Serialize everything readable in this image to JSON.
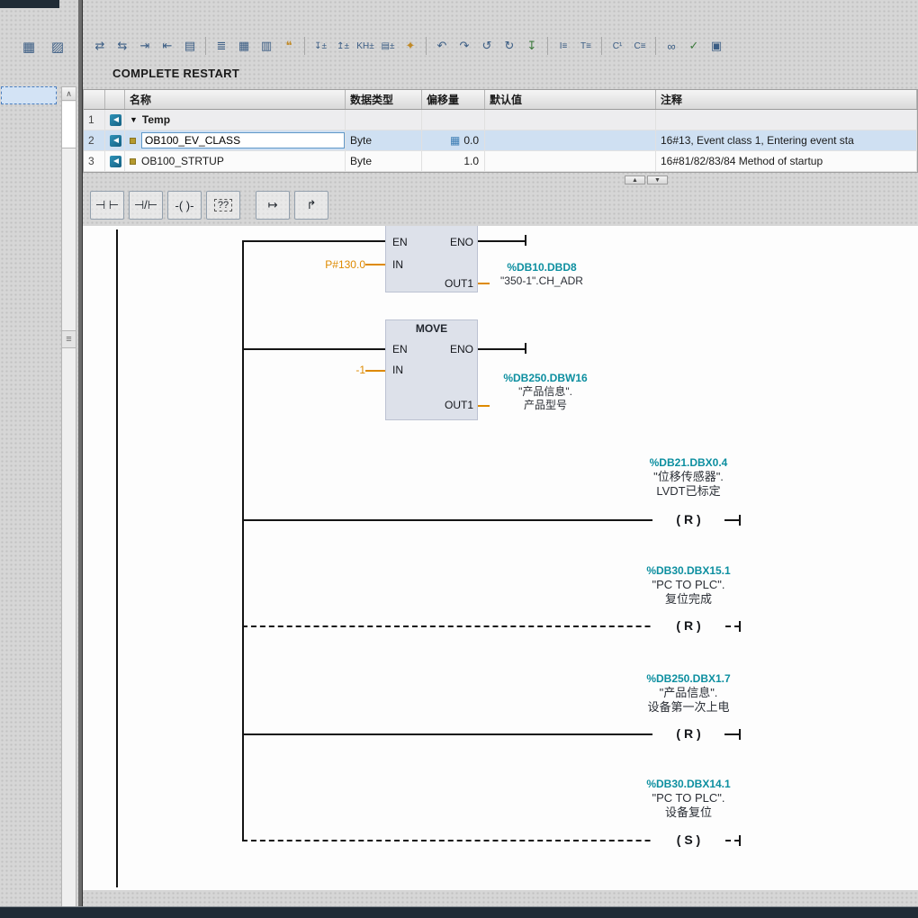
{
  "colors": {
    "teal": "#0d8fa0",
    "orange": "#de8a00",
    "selection": "#cfe0f2",
    "chrome": "#202b36",
    "wire": "#141414"
  },
  "title": "COMPLETE RESTART",
  "left_toolbar": {
    "icons": [
      {
        "name": "overview-icon",
        "glyph": "▦"
      },
      {
        "name": "detail-view-icon",
        "glyph": "▨"
      }
    ]
  },
  "toolbar": {
    "icons": [
      {
        "name": "insert-network-icon",
        "glyph": "⇄"
      },
      {
        "name": "delete-network-icon",
        "glyph": "⇆"
      },
      {
        "name": "indent-right-icon",
        "glyph": "⇥"
      },
      {
        "name": "indent-left-icon",
        "glyph": "⇤"
      },
      {
        "name": "insert-row-icon",
        "glyph": "▤"
      },
      {
        "name": "network-list-icon",
        "glyph": "≣"
      },
      {
        "name": "network-overview-icon",
        "glyph": "▦"
      },
      {
        "name": "network-compact-icon",
        "glyph": "▥"
      },
      {
        "name": "comment-toggle-icon",
        "glyph": "❝"
      },
      {
        "name": "expand-all-icon",
        "glyph": "↧±"
      },
      {
        "name": "collapse-all-icon",
        "glyph": "↥±"
      },
      {
        "name": "address-format-icon",
        "glyph": "KH±"
      },
      {
        "name": "operand-info-icon",
        "glyph": "▤±"
      },
      {
        "name": "favorites-icon",
        "glyph": "✦"
      },
      {
        "name": "undo-icon",
        "glyph": "↶"
      },
      {
        "name": "redo-icon",
        "glyph": "↷"
      },
      {
        "name": "goto-previous-icon",
        "glyph": "↺"
      },
      {
        "name": "goto-next-icon",
        "glyph": "↻"
      },
      {
        "name": "download-icon",
        "glyph": "↧"
      },
      {
        "name": "monitor-values-icon",
        "glyph": "I≡"
      },
      {
        "name": "modify-values-icon",
        "glyph": "T≡"
      },
      {
        "name": "call-environment-icon",
        "glyph": "C¹"
      },
      {
        "name": "call-structure-icon",
        "glyph": "C≡"
      },
      {
        "name": "cross-reference-icon",
        "glyph": "∞"
      },
      {
        "name": "gsd-check-icon",
        "glyph": "✓"
      },
      {
        "name": "block-properties-icon",
        "glyph": "▣"
      }
    ]
  },
  "sidebar": {
    "scroll_up_glyph": "∧",
    "grip_glyph": "≡"
  },
  "table": {
    "headers": [
      "名称",
      "数据类型",
      "偏移量",
      "默认值",
      "注释"
    ],
    "offset_icon_glyph": "▦",
    "rows": [
      {
        "num": "1",
        "expander": "▼",
        "name": "Temp",
        "type": "",
        "offset": "",
        "default": "",
        "comment": ""
      },
      {
        "num": "2",
        "name": "OB100_EV_CLASS",
        "type": "Byte",
        "offset": "0.0",
        "default": "",
        "comment": "16#13, Event class 1, Entering event sta"
      },
      {
        "num": "3",
        "name": "OB100_STRTUP",
        "type": "Byte",
        "offset": "1.0",
        "default": "",
        "comment": "16#81/82/83/84 Method of startup"
      }
    ]
  },
  "table_scroll": {
    "up": "▲",
    "down": "▼"
  },
  "ladder_toolbar": {
    "buttons": [
      {
        "name": "contact-open-button",
        "glyph": "⊣ ⊢"
      },
      {
        "name": "contact-closed-button",
        "glyph": "⊣/⊢"
      },
      {
        "name": "coil-button",
        "glyph": "-( )-"
      },
      {
        "name": "empty-box-button",
        "glyph": "??"
      },
      {
        "name": "open-branch-button",
        "glyph": "↦"
      },
      {
        "name": "close-branch-button",
        "glyph": "↱"
      }
    ]
  },
  "ladder": {
    "labels": {
      "en": "EN",
      "eno": "ENO",
      "in": "IN",
      "out1": "OUT1"
    },
    "block1": {
      "in_value": "P#130.0",
      "out_addr": "%DB10.DBD8",
      "out_name": "\"350-1\".CH_ADR"
    },
    "block2": {
      "title": "MOVE",
      "in_value": "-1",
      "out_addr": "%DB250.DBW16",
      "out_name": "\"产品信息\".",
      "out_name2": "产品型号"
    },
    "coils": [
      {
        "addr": "%DB21.DBX0.4",
        "name": "\"位移传感器\".",
        "name2": "LVDT已标定",
        "symbol": "( R )"
      },
      {
        "addr": "%DB30.DBX15.1",
        "name": "\"PC TO PLC\".",
        "name2": "复位完成",
        "symbol": "( R )"
      },
      {
        "addr": "%DB250.DBX1.7",
        "name": "\"产品信息\".",
        "name2": "设备第一次上电",
        "symbol": "( R )"
      },
      {
        "addr": "%DB30.DBX14.1",
        "name": "\"PC TO PLC\".",
        "name2": "设备复位",
        "symbol": "( S )"
      }
    ]
  }
}
